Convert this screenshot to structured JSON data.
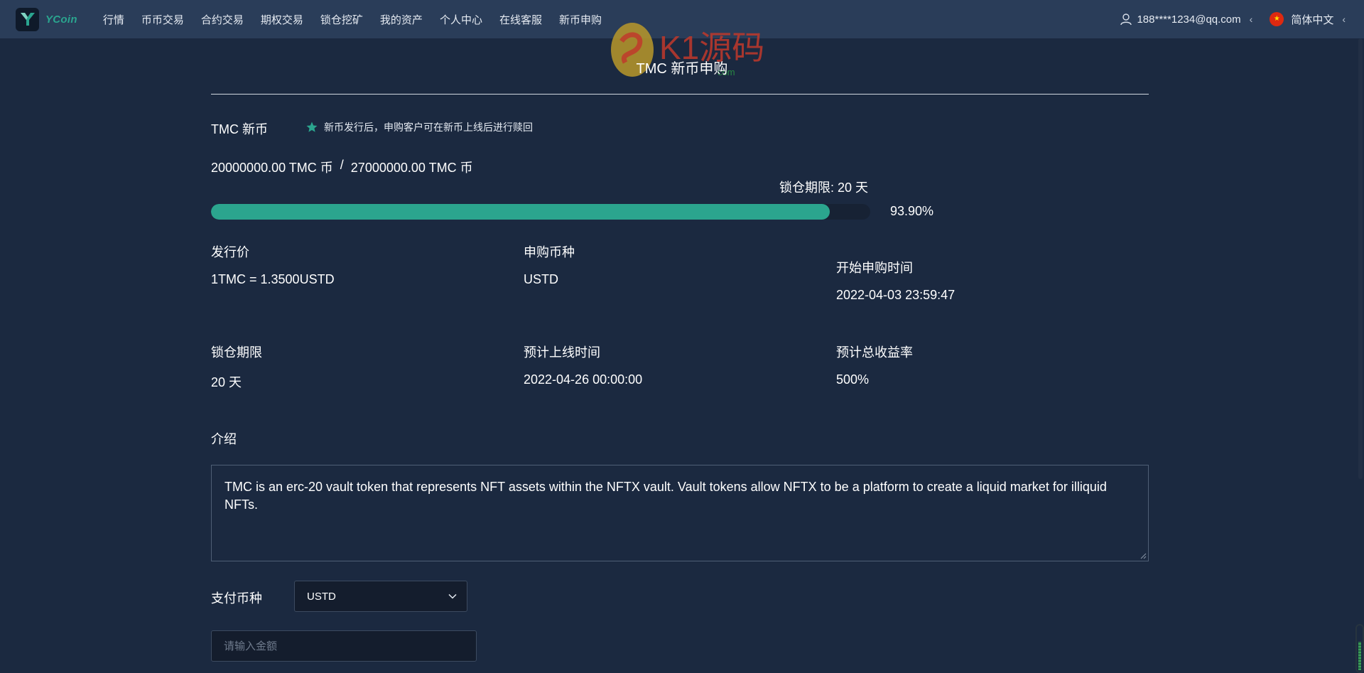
{
  "brand": {
    "name": "YCoin"
  },
  "nav": {
    "items": [
      "行情",
      "币币交易",
      "合约交易",
      "期权交易",
      "锁仓挖矿",
      "我的资产",
      "个人中心",
      "在线客服",
      "新币申购"
    ]
  },
  "user": {
    "email": "188****1234@qq.com",
    "language": "简体中文"
  },
  "watermark": {
    "text": "K1源码",
    "sub": "com"
  },
  "page": {
    "title": "TMC 新币申购"
  },
  "coin": {
    "name": "TMC 新币",
    "note": "新币发行后，申购客户可在新币上线后进行赎回",
    "subscribed": "20000000.00 TMC 币",
    "separator": "/",
    "total": "27000000.00 TMC 币",
    "lock_period_top": "锁仓期限: 20 天",
    "progress_fraction": 0.939,
    "progress_text": "93.90%"
  },
  "details": [
    {
      "label": "发行价",
      "value": "1TMC = 1.3500USTD"
    },
    {
      "label": "申购币种",
      "value": "USTD"
    },
    {
      "label": "开始申购时间",
      "value": "2022-04-03 23:59:47"
    },
    {
      "label": "锁仓期限",
      "value": "20 天"
    },
    {
      "label": "预计上线时间",
      "value": "2022-04-26 00:00:00"
    },
    {
      "label": "预计总收益率",
      "value": "500%"
    }
  ],
  "intro": {
    "label": "介绍",
    "text": "TMC is an erc-20 vault token that represents NFT assets within the NFTX vault. Vault tokens allow NFTX to be a platform to create a liquid market for illiquid NFTs."
  },
  "payment": {
    "label": "支付币种",
    "selected": "USTD",
    "amount_placeholder": "请输入金额"
  },
  "colors": {
    "accent": "#2ba58e",
    "background": "#1b2940",
    "nav": "#2a3d59"
  }
}
